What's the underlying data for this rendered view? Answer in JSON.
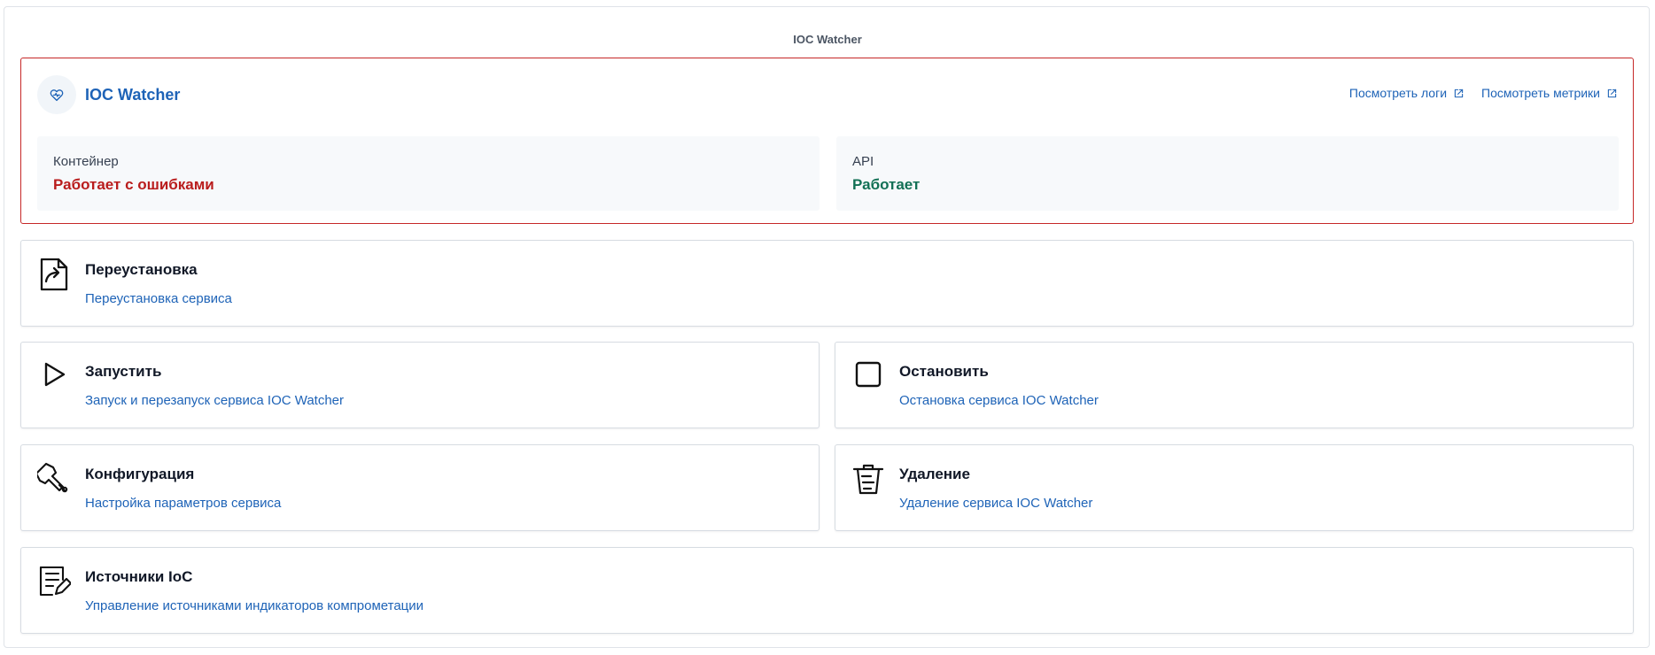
{
  "page": {
    "title": "IOC Watcher"
  },
  "service": {
    "name": "IOC Watcher",
    "icon": "heart-pulse-icon",
    "links": {
      "logs": "Посмотреть логи",
      "metrics": "Посмотреть метрики"
    }
  },
  "status": {
    "container": {
      "label": "Контейнер",
      "value": "Работает с ошибками",
      "color": "#b91c1c"
    },
    "api": {
      "label": "API",
      "value": "Работает",
      "color": "#127055"
    },
    "alert_border_color": "#c62828"
  },
  "actions": {
    "reinstall": {
      "title": "Переустановка",
      "description": "Переустановка сервиса",
      "icon": "reinstall-file-icon"
    },
    "start": {
      "title": "Запустить",
      "description": "Запуск и перезапуск сервиса IOC Watcher",
      "icon": "play-icon"
    },
    "stop": {
      "title": "Остановить",
      "description": "Остановка сервиса IOC Watcher",
      "icon": "stop-icon"
    },
    "configuration": {
      "title": "Конфигурация",
      "description": "Настройка параметров сервиса",
      "icon": "wrench-icon"
    },
    "delete": {
      "title": "Удаление",
      "description": "Удаление сервиса IOC Watcher",
      "icon": "trash-icon"
    },
    "ioc_sources": {
      "title": "Источники IoC",
      "description": "Управление источниками индикаторов компрометации",
      "icon": "list-edit-icon"
    }
  },
  "theme": {
    "link_color": "#1e63b7"
  }
}
